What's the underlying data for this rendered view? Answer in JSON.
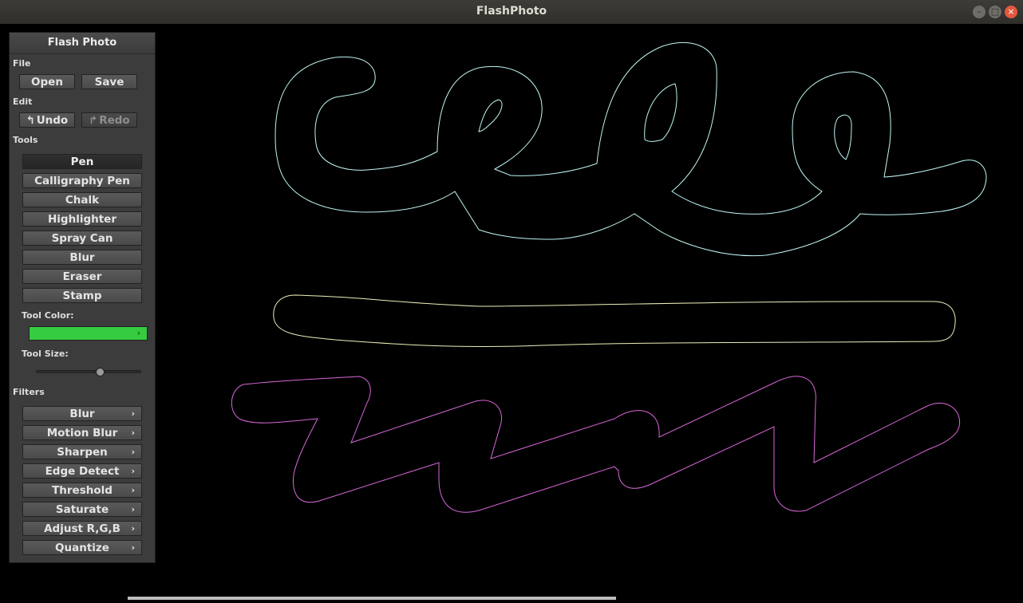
{
  "window": {
    "title": "FlashPhoto"
  },
  "panel": {
    "title": "Flash Photo",
    "file": {
      "label": "File",
      "open": "Open",
      "save": "Save"
    },
    "edit": {
      "label": "Edit",
      "undo": "Undo",
      "redo": "Redo"
    },
    "tools": {
      "label": "Tools",
      "items": [
        "Pen",
        "Calligraphy Pen",
        "Chalk",
        "Highlighter",
        "Spray Can",
        "Blur",
        "Eraser",
        "Stamp"
      ],
      "selected": "Pen"
    },
    "tool_color": {
      "label": "Tool Color:",
      "value": "#35cb41"
    },
    "tool_size": {
      "label": "Tool Size:",
      "value": 0.62
    },
    "filters": {
      "label": "Filters",
      "items": [
        "Blur",
        "Motion Blur",
        "Sharpen",
        "Edge Detect",
        "Threshold",
        "Saturate",
        "Adjust R,G,B",
        "Quantize"
      ]
    }
  },
  "strokes": {
    "cursive": "#bff6f4",
    "line": "#efeebb",
    "zigzag": "#d867d8"
  }
}
